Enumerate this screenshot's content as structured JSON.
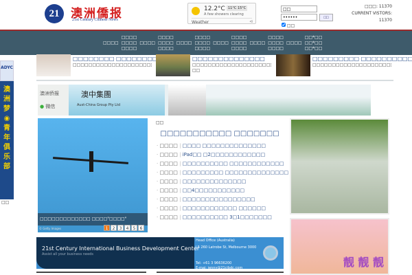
{
  "header": {
    "logo_mark": "21",
    "logo_cn": "澳洲僑报",
    "logo_en": "21st Century Chinese News",
    "weather": {
      "temp": "12.2°C",
      "range": "11°C  15°C",
      "desc": "A few showers clearing",
      "label": "Weather",
      "loc_icon": "⊲"
    },
    "login": {
      "username": "□□",
      "password": "••••••",
      "button": "□□",
      "remember": "□□",
      "remember_checked": true
    },
    "stats": {
      "line1": "□□□: 11370",
      "line2": "CURRENT VISTORS:",
      "line3": "11370"
    }
  },
  "nav": [
    "□□□□",
    "□□□□\n□□□□\n□□□□",
    "□□□□",
    "□□□□\n□□□□\n□□□□",
    "□□□□",
    "□□□□\n□□□□\n□□□□",
    "□□□□",
    "□□□□\n□□□□\n□□□□",
    "□□□□",
    "□□□□\n□□□□\n□□□□",
    "□□□□",
    "□□*□□\n□□*□□\n□□*□□"
  ],
  "side_ad": {
    "top": "ADYC",
    "body": "澳\n洲\n梦\n◉\n青\n年\n俱\n乐\n部",
    "label": "□□"
  },
  "news": [
    {
      "title": "□□□□□□□□ □□□□□□□□□□□□□",
      "desc": "□□□□□□□□□□□□□□□□□□□□□□□□□□□□□□□□□□□□"
    },
    {
      "title": "□□□□□□□□□□□□□□",
      "desc": "□□□□□□□□□□□□□□□□□□□□□□□ABC□ □□"
    },
    {
      "title": "□□□□□□□□□ □□□□□□□□□□",
      "desc": "□□□□□□□□□□□□□□□□□□□□□□□□□□□□□□□□□□□□□"
    }
  ],
  "banner": {
    "wechat1": "澳洲侨报",
    "wechat2": "微信",
    "company_cn": "澳中集團",
    "company_en": "Aust-China Group Pty Ltd"
  },
  "slideshow": {
    "caption": "□□□□□□□□□□□□□ □□□□\"□□□□\"",
    "credit": "© Getty Images",
    "pages": [
      "1",
      "2",
      "3",
      "4",
      "5",
      "6"
    ],
    "active": 0
  },
  "center": {
    "header": "□□",
    "title": "□□□□□□□□□□□ □□□□□□□",
    "items": [
      {
        "cat": "□□□□",
        "text": "□□□□ □□□□□□□□□□□□□□"
      },
      {
        "cat": "□□□□",
        "text": "iPad□□ □2□□□□□□□□□□□□"
      },
      {
        "cat": "□□□□",
        "text": "□□□□□□□□□□ □□□□□□□□□□□□"
      },
      {
        "cat": "□□□□",
        "text": "□□□□□□□□□ □□□□□□□□□□□□□□"
      },
      {
        "cat": "□□□□",
        "text": "□□□□□□□□□□□□□□"
      },
      {
        "cat": "□□□□",
        "text": "□□4□□□□□□□□□□□"
      },
      {
        "cat": "□□□□",
        "text": "□□□□□□□□□□□□□□□□"
      },
      {
        "cat": "□□□□",
        "text": "□□□□□□□□□□□□ □□□□□□"
      },
      {
        "cat": "□□□□",
        "text": "□□□□□□□□□□ 3□1□□□□□□□"
      }
    ]
  },
  "right_ad": {
    "text": "靓 靓 靓"
  },
  "biz_banner": {
    "title": "21st Century International Business Development Center",
    "subtitle": "Assist all your business needs",
    "office": "Head Office (Australia)",
    "address": "L5 260 Latrobe St, Melbourne 3000",
    "tel": "Tel: +61 3 96636200",
    "email": "E-mai: jenny@21cibdc.com"
  }
}
